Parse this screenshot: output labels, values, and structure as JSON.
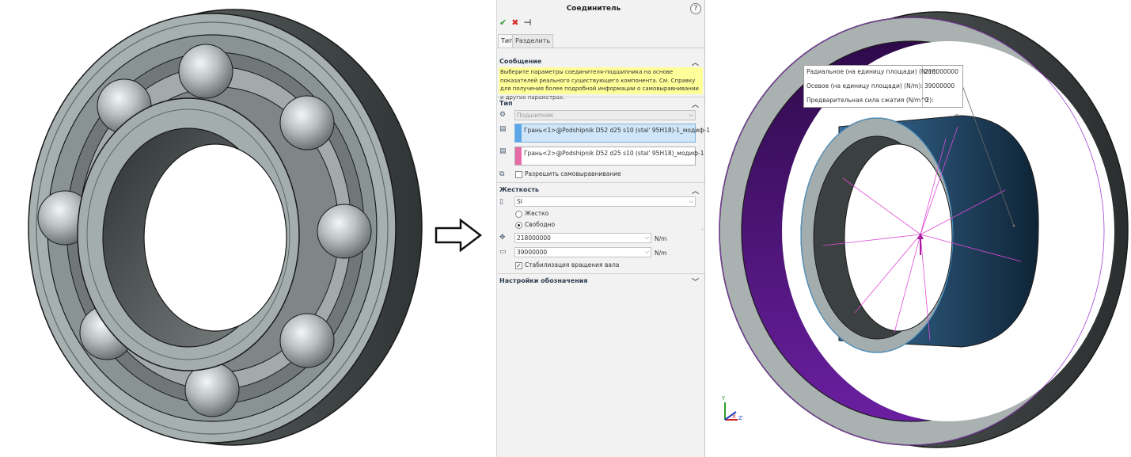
{
  "panel": {
    "title": "Соединитель",
    "help_symbol": "?",
    "ok_symbol": "✔",
    "cancel_symbol": "✖",
    "pin_symbol": "⊣",
    "tabs": [
      {
        "label": "Тип"
      },
      {
        "label": "Разделить"
      }
    ],
    "message": {
      "header": "Сообщение",
      "text": "Выберите параметры соединителя-подшипника на основе показателей реального существующего компонента. См. Справку для получения более подробной информации о самовыравнивании и других параметрах."
    },
    "type_section": {
      "header": "Тип",
      "connector_type": "Подшипник",
      "selection1": "Грань<1>@Podshipnik D52 d25 s10 (stal' 95Н18)-1_модиф-1",
      "selection2": "Грань<2>@Podshipnik D52 d25 s10 (stal' 95Н18)_модиф-1",
      "allow_self_align": "Разрешить самовыравнивание"
    },
    "stiffness_section": {
      "header": "Жесткость",
      "unit_system": "SI",
      "option_rigid": "Жестко",
      "option_free": "Свободно",
      "radial_value": "218000000",
      "axial_value": "39000000",
      "unit_radial": "N/m",
      "unit_axial": "N/m",
      "stabilize_shaft": "Стабилизация вращения вала"
    },
    "display_section": {
      "header": "Настройки обозначения"
    }
  },
  "tooltip": {
    "rows": [
      {
        "label": "Радиальное (на единицу площади) (N/m):",
        "value": "218000000"
      },
      {
        "label": "Осевое (на единицу площади) (N/m):",
        "value": "39000000"
      },
      {
        "label": "Предварительная сила сжатия (N/m^2):",
        "value": "0"
      }
    ]
  },
  "triad": {
    "y": "Y",
    "x": "X",
    "z": "Z"
  },
  "colors": {
    "accent_purple": "#5a1d86",
    "message_bg": "#ffff99",
    "selection_blue": "#5aa6e6",
    "selection_pink": "#e66aa8",
    "inner_ring_blue": "#2a5d8c"
  }
}
